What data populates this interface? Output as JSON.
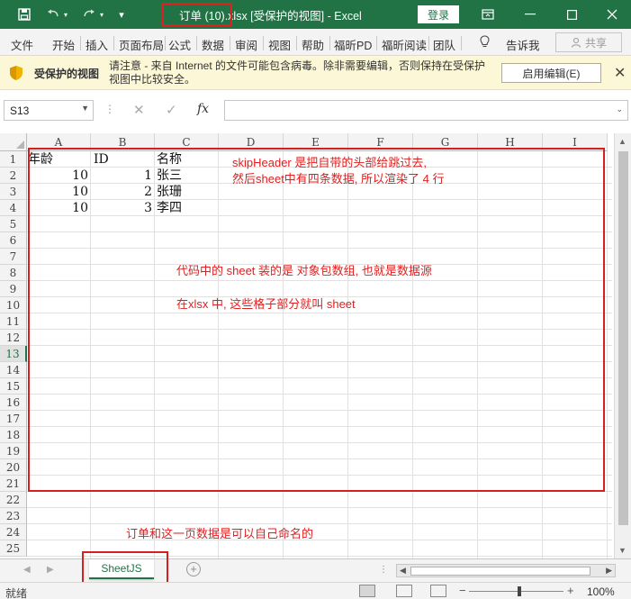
{
  "titlebar": {
    "save_icon": "save-icon",
    "undo_icon": "undo-icon",
    "redo_icon": "redo-icon",
    "customize_icon": "customize-quick-access-icon",
    "title": "订单 (10).xlsx  [受保护的视图]  -  Excel",
    "login_label": "登录",
    "accent_color": "#217346"
  },
  "ribbon": {
    "tabs": [
      "文件",
      "开始",
      "插入",
      "页面布局",
      "公式",
      "数据",
      "审阅",
      "视图",
      "帮助",
      "福昕PD",
      "福昕阅读",
      "团队"
    ],
    "tell_me_label": "告诉我",
    "share_label": "共享"
  },
  "banner": {
    "title": "受保护的视图",
    "message": "请注意 - 来自 Internet 的文件可能包含病毒。除非需要编辑，否则保持在受保护视图中比较安全。",
    "enable_edit_label": "启用编辑(E)"
  },
  "formula_bar": {
    "name_box": "S13",
    "fx_label": "fx",
    "formula": ""
  },
  "grid": {
    "columns": [
      "A",
      "B",
      "C",
      "D",
      "E",
      "F",
      "G",
      "H",
      "I"
    ],
    "rows": [
      "1",
      "2",
      "3",
      "4",
      "5",
      "6",
      "7",
      "8",
      "9",
      "10",
      "11",
      "12",
      "13",
      "14",
      "15",
      "16",
      "17",
      "18",
      "19",
      "20",
      "21",
      "22",
      "23",
      "24",
      "25"
    ],
    "selected_row": "13",
    "cells": {
      "A1": "年龄",
      "B1": "ID",
      "C1": "名称",
      "A2": "10",
      "B2": "1",
      "C2": "张三",
      "A3": "10",
      "B3": "2",
      "C3": "张珊",
      "A4": "10",
      "B4": "3",
      "C4": "李四"
    }
  },
  "annotations": {
    "note1_line1": "skipHeader 是把自带的头部给跳过去,",
    "note1_line2": "然后sheet中有四条数据, 所以渲染了 4 行",
    "note2": "代码中的 sheet 装的是 对象包数组, 也就是数据源",
    "note3": "在xlsx 中, 这些格子部分就叫 sheet",
    "note4": "订单和这一页数据是可以自己命名的",
    "color": "#e02020"
  },
  "sheets": {
    "tabs": [
      "SheetJS"
    ],
    "active": "SheetJS"
  },
  "status": {
    "ready": "就绪",
    "zoom": "100%"
  }
}
